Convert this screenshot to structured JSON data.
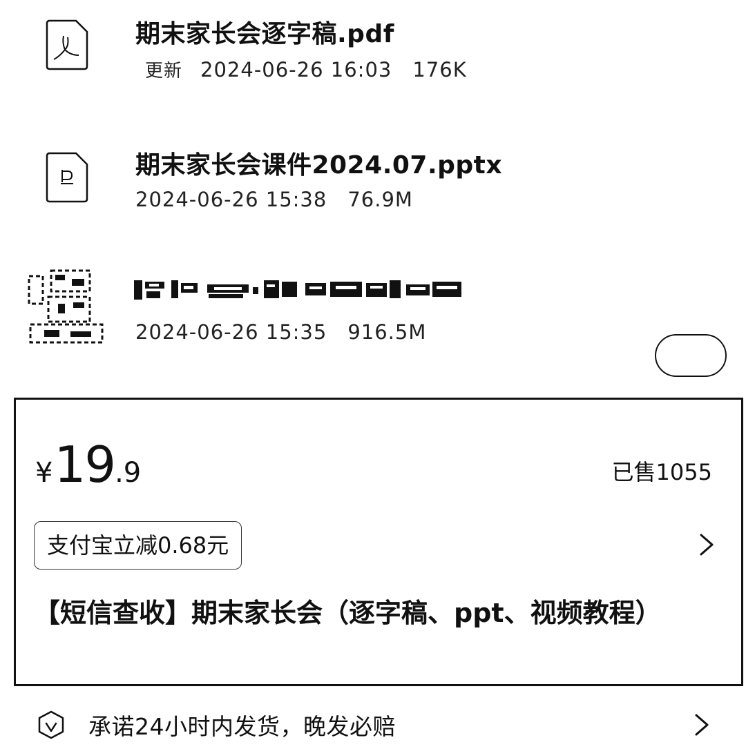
{
  "files": [
    {
      "name": "期末家长会逐字稿.pdf",
      "tag": "更新",
      "date": "2024-06-26 16:03",
      "size": "176K",
      "icon": "pdf-file-icon"
    },
    {
      "name": "期末家长会课件2024.07.pptx",
      "date": "2024-06-26 15:38",
      "size": "76.9M",
      "icon": "pptx-file-icon"
    },
    {
      "name": "",
      "date": "2024-06-26 15:35",
      "size": "916.5M",
      "icon": "redacted-file-icon"
    }
  ],
  "product": {
    "currency": "¥",
    "price_int": "19",
    "price_dec": ".9",
    "sold": "已售1055",
    "promo": "支付宝立减0.68元",
    "title": "【短信查收】期末家长会（逐字稿、ppt、视频教程）"
  },
  "guarantee": {
    "text": "承诺24小时内发货，晚发必赔",
    "icon": "shield-icon"
  }
}
